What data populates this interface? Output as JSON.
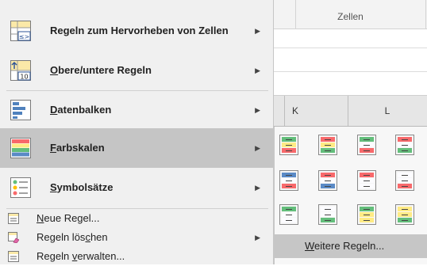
{
  "ribbon": {
    "group_label": "Zellen"
  },
  "columns": [
    "K",
    "L"
  ],
  "menu": {
    "big_items": [
      {
        "label": "Regeln zum Hervorheben von Zellen",
        "icon": "highlight-cells-rules-icon"
      },
      {
        "label": "Obere/untere Regeln",
        "icon": "top-bottom-rules-icon"
      },
      {
        "label": "Datenbalken",
        "icon": "data-bars-icon"
      },
      {
        "label": "Farbskalen",
        "icon": "color-scales-icon"
      },
      {
        "label": "Symbolsätze",
        "icon": "icon-sets-icon"
      }
    ],
    "small_items": [
      {
        "label": "Neue Regel...",
        "icon": "new-rule-icon"
      },
      {
        "label": "Regeln löschen",
        "icon": "clear-rules-icon"
      },
      {
        "label": "Regeln verwalten...",
        "icon": "manage-rules-icon"
      }
    ]
  },
  "submenu": {
    "title": "Farbskalen",
    "more_rules": "Weitere Regeln...",
    "swatch_rows": [
      [
        [
          "#63be7b",
          "#ffeb84",
          "#f8696b"
        ],
        [
          "#f8696b",
          "#ffeb84",
          "#63be7b"
        ],
        [
          "#63be7b",
          "#fcfcff",
          "#f8696b"
        ],
        [
          "#f8696b",
          "#fcfcff",
          "#63be7b"
        ]
      ],
      [
        [
          "#5a8ac6",
          "#fcfcff",
          "#f8696b"
        ],
        [
          "#f8696b",
          "#fcfcff",
          "#5a8ac6"
        ],
        [
          "#f8696b",
          "#fcfcff",
          "#fcfcff"
        ],
        [
          "#fcfcff",
          "#fcfcff",
          "#f8696b"
        ]
      ],
      [
        [
          "#63be7b",
          "#fcfcff",
          "#fcfcff"
        ],
        [
          "#fcfcff",
          "#fcfcff",
          "#63be7b"
        ],
        [
          "#63be7b",
          "#ffeb84",
          "#ffeb84"
        ],
        [
          "#ffeb84",
          "#ffeb84",
          "#63be7b"
        ]
      ]
    ]
  },
  "colors": {
    "menu_bg": "#f0f0f0",
    "highlight": "#c5c5c5",
    "submenu_bg": "#f7f7f7"
  }
}
